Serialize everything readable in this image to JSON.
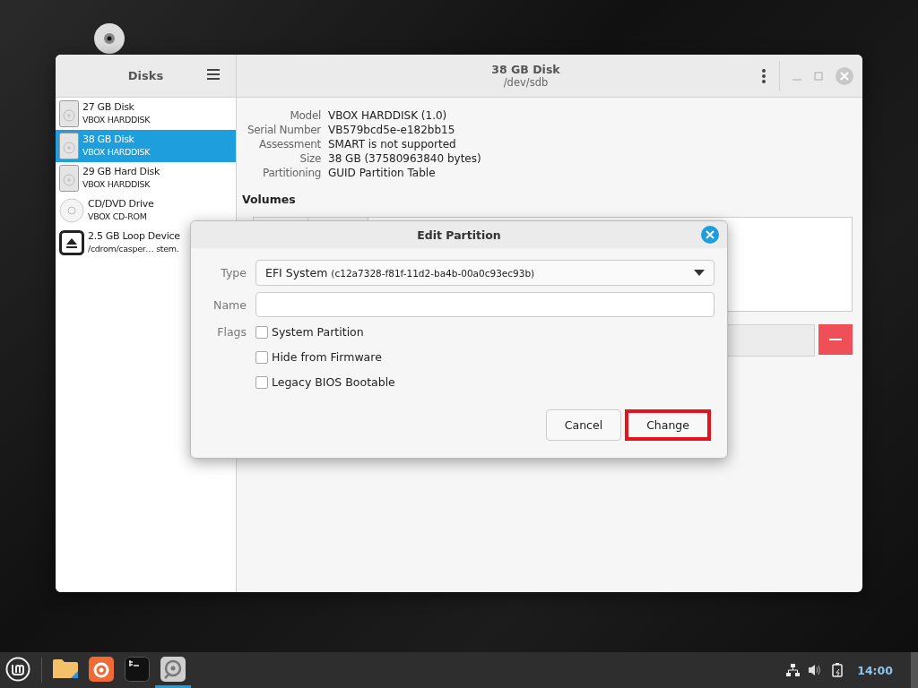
{
  "window": {
    "sidebar_title": "Disks",
    "title": "38 GB Disk",
    "subtitle": "/dev/sdb"
  },
  "drives": [
    {
      "kind": "hdd",
      "name": "27 GB Disk",
      "detail": "VBOX HARDDISK",
      "selected": false
    },
    {
      "kind": "hdd",
      "name": "38 GB Disk",
      "detail": "VBOX HARDDISK",
      "selected": true
    },
    {
      "kind": "hdd",
      "name": "29 GB Hard Disk",
      "detail": "VBOX HARDDISK",
      "selected": false
    },
    {
      "kind": "optical",
      "name": "CD/DVD Drive",
      "detail": "VBOX CD-ROM",
      "selected": false
    },
    {
      "kind": "loop",
      "name": "2.5 GB Loop Device",
      "detail": "/cdrom/casper… stem.",
      "selected": false
    }
  ],
  "properties": [
    {
      "label": "Model",
      "value": "VBOX HARDDISK (1.0)"
    },
    {
      "label": "Serial Number",
      "value": "VB579bcd5e-e182bb15"
    },
    {
      "label": "Assessment",
      "value": "SMART is not supported"
    },
    {
      "label": "Size",
      "value": "38 GB (37580963840 bytes)"
    },
    {
      "label": "Partitioning",
      "value": "GUID Partition Table"
    }
  ],
  "volumes_heading": "Volumes",
  "dialog": {
    "title": "Edit Partition",
    "type_label": "Type",
    "type_value": "EFI System",
    "type_guid": "(c12a7328-f81f-11d2-ba4b-00a0c93ec93b)",
    "name_label": "Name",
    "flags_label": "Flags",
    "flags": [
      {
        "label": "System Partition",
        "checked": false
      },
      {
        "label": "Hide from Firmware",
        "checked": false
      },
      {
        "label": "Legacy BIOS Bootable",
        "checked": false
      }
    ],
    "buttons": [
      {
        "label": "Cancel",
        "highlighted": false
      },
      {
        "label": "Change",
        "highlighted": true
      }
    ]
  },
  "taskbar": {
    "clock": "14:00"
  }
}
